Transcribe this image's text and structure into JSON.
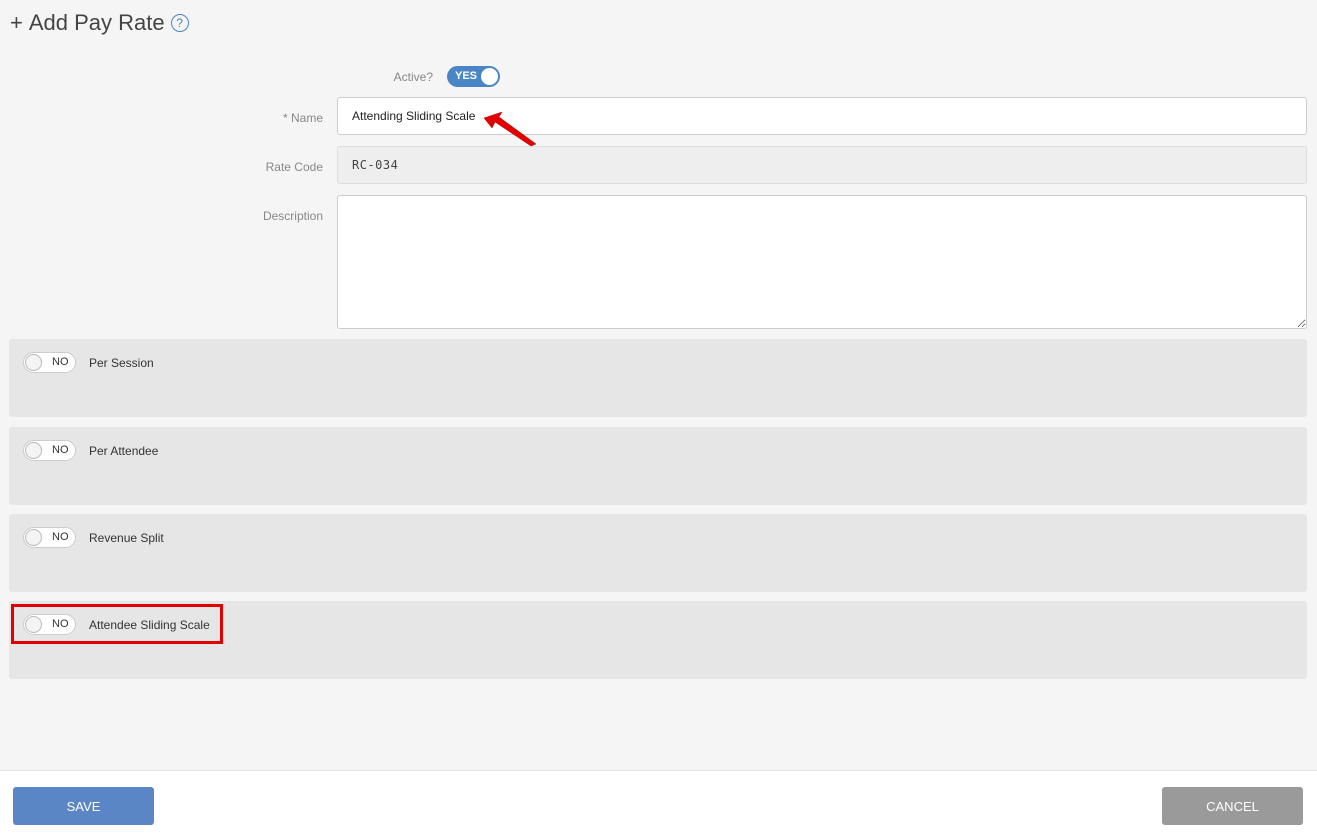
{
  "header": {
    "plus": "+",
    "title": "Add Pay Rate",
    "help": "?"
  },
  "form": {
    "active_label": "Active?",
    "active_value": "YES",
    "name_label": "* Name",
    "name_value": "Attending Sliding Scale",
    "rate_code_label": "Rate Code",
    "rate_code_value": "RC-034",
    "description_label": "Description",
    "description_value": ""
  },
  "options": [
    {
      "toggle": "NO",
      "label": "Per Session"
    },
    {
      "toggle": "NO",
      "label": "Per Attendee"
    },
    {
      "toggle": "NO",
      "label": "Revenue Split"
    },
    {
      "toggle": "NO",
      "label": "Attendee Sliding Scale"
    }
  ],
  "footer": {
    "save_label": "SAVE",
    "cancel_label": "CANCEL"
  },
  "colors": {
    "accent": "#4a86c5",
    "highlight": "#e30000",
    "save": "#5a86c5",
    "cancel": "#9a9a9a"
  }
}
